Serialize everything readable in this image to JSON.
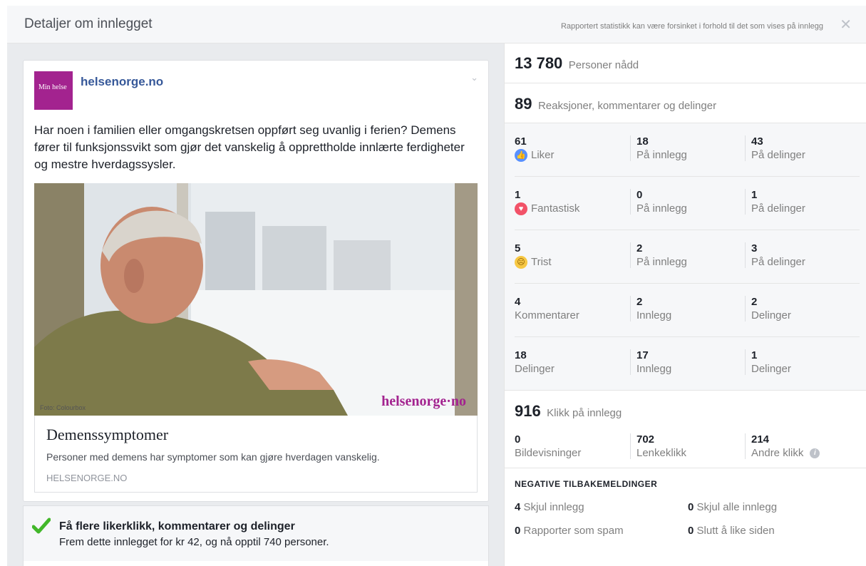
{
  "header": {
    "title": "Detaljer om innlegget",
    "note": "Rapportert statistikk kan være forsinket i forhold til det som vises på innlegg",
    "close_glyph": "✕"
  },
  "post": {
    "avatar_text": "Min helse",
    "page_name": "helsenorge.no",
    "text": "Har noen i familien eller omgangskretsen oppført seg uvanlig i ferien? Demens fører til funksjonssvikt som gjør det vanskelig å opprettholde innlærte ferdigheter og mestre hverdagssysler.",
    "image": {
      "photo_credit": "Foto: Colourbox",
      "brand": "helsenorge·no"
    },
    "link": {
      "title": "Demenssymptomer",
      "description": "Personer med demens har symptomer som kan gjøre hverdagen vanskelig.",
      "domain": "HELSENORGE.NO"
    }
  },
  "boost": {
    "title": "Få flere likerklikk, kommentarer og delinger",
    "subtitle": "Frem dette innlegget for kr 42, og nå opptil 740 personer."
  },
  "reach": {
    "value": "13 780",
    "label": "Personer nådd"
  },
  "engagement": {
    "value": "89",
    "label": "Reaksjoner, kommentarer og delinger"
  },
  "stats": [
    {
      "icon": "like-icon",
      "c1": {
        "num": "61",
        "label": "Liker"
      },
      "c2": {
        "num": "18",
        "label": "På innlegg"
      },
      "c3": {
        "num": "43",
        "label": "På delinger"
      }
    },
    {
      "icon": "love-icon",
      "c1": {
        "num": "1",
        "label": "Fantastisk"
      },
      "c2": {
        "num": "0",
        "label": "På innlegg"
      },
      "c3": {
        "num": "1",
        "label": "På delinger"
      }
    },
    {
      "icon": "sad-icon",
      "c1": {
        "num": "5",
        "label": "Trist"
      },
      "c2": {
        "num": "2",
        "label": "På innlegg"
      },
      "c3": {
        "num": "3",
        "label": "På delinger"
      }
    },
    {
      "icon": "",
      "c1": {
        "num": "4",
        "label": "Kommentarer"
      },
      "c2": {
        "num": "2",
        "label": "Innlegg"
      },
      "c3": {
        "num": "2",
        "label": "Delinger"
      }
    },
    {
      "icon": "",
      "c1": {
        "num": "18",
        "label": "Delinger"
      },
      "c2": {
        "num": "17",
        "label": "Innlegg"
      },
      "c3": {
        "num": "1",
        "label": "Delinger"
      }
    }
  ],
  "clicks": {
    "value": "916",
    "label": "Klikk på innlegg",
    "items": [
      {
        "num": "0",
        "label": "Bildevisninger"
      },
      {
        "num": "702",
        "label": "Lenkeklikk"
      },
      {
        "num": "214",
        "label": "Andre klikk"
      }
    ]
  },
  "negative": {
    "title": "NEGATIVE TILBAKEMELDINGER",
    "items": [
      {
        "num": "4",
        "label": "Skjul innlegg"
      },
      {
        "num": "0",
        "label": "Skjul alle innlegg"
      },
      {
        "num": "0",
        "label": "Rapporter som spam"
      },
      {
        "num": "0",
        "label": "Slutt å like siden"
      }
    ]
  },
  "colors": {
    "brand_purple": "#a3238f",
    "link_blue": "#365899",
    "like_blue": "#5890ff",
    "love_red": "#f25268",
    "sad_yellow": "#f7c844",
    "check_green": "#42b72a"
  }
}
